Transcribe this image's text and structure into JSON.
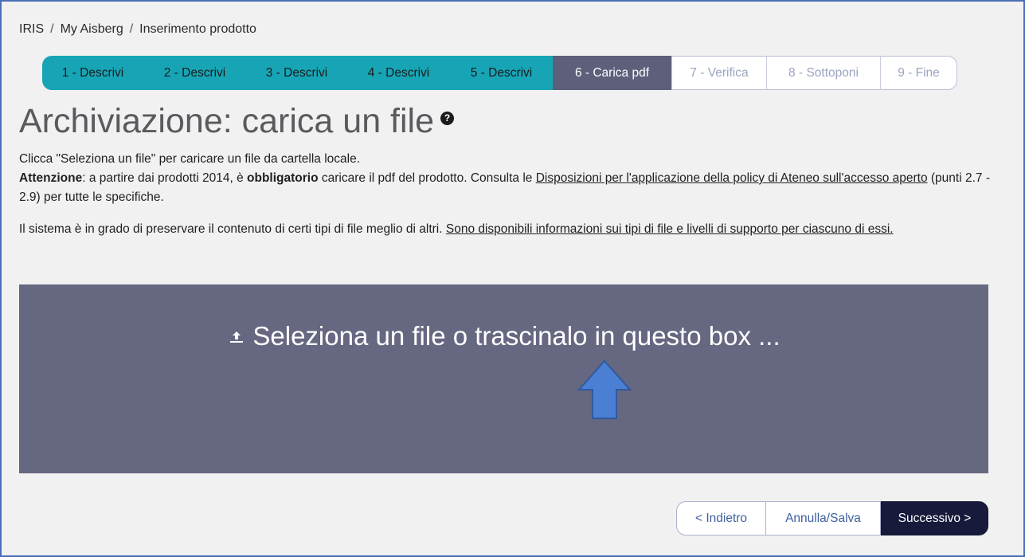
{
  "breadcrumb": {
    "items": [
      "IRIS",
      "My Aisberg",
      "Inserimento prodotto"
    ],
    "separator": "/"
  },
  "steps": [
    {
      "label": "1 - Descrivi",
      "state": "done"
    },
    {
      "label": "2 - Descrivi",
      "state": "done"
    },
    {
      "label": "3 - Descrivi",
      "state": "done"
    },
    {
      "label": "4 - Descrivi",
      "state": "done"
    },
    {
      "label": "5 - Descrivi",
      "state": "done"
    },
    {
      "label": "6 - Carica pdf",
      "state": "current"
    },
    {
      "label": "7 - Verifica",
      "state": "todo"
    },
    {
      "label": "8 - Sottoponi",
      "state": "todo"
    },
    {
      "label": "9 - Fine",
      "state": "todo"
    }
  ],
  "page": {
    "title": "Archiviazione: carica un file",
    "help_icon": "question-circle-icon"
  },
  "instructions": {
    "line1": "Clicca \"Seleziona un file\" per caricare un file da cartella locale.",
    "warning_label": "Attenzione",
    "warning_text_1": ": a partire dai prodotti 2014, è ",
    "warning_bold": "obbligatorio",
    "warning_text_2": " caricare il pdf del prodotto. Consulta le ",
    "policy_link": "Disposizioni per l'applicazione della policy di Ateneo sull'accesso aperto",
    "warning_text_3": " (punti 2.7 - 2.9) per tutte le specifiche.",
    "formats_text": "Il sistema è in grado di preservare il contenuto di certi tipi di file meglio di altri. ",
    "formats_link": "Sono disponibili informazioni sui tipi di file e livelli di supporto per ciascuno di essi."
  },
  "dropzone": {
    "label": "Seleziona un file o trascinalo in questo box ...",
    "icon": "upload-icon",
    "arrow_color": "#4a7fd4"
  },
  "navigation": {
    "back_label": "< Indietro",
    "save_label": "Annulla/Salva",
    "next_label": "Successivo >"
  },
  "colors": {
    "step_done": "#17a5b6",
    "step_current": "#5d5f7b",
    "dropzone_bg": "#666781",
    "next_button": "#171a3b"
  }
}
